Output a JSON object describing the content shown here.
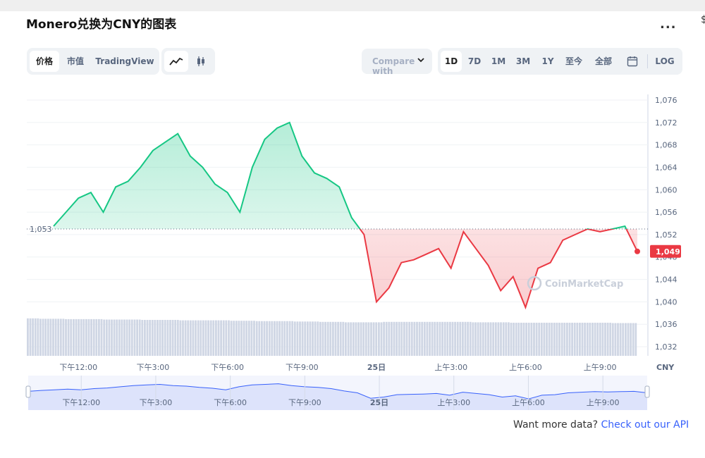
{
  "header": {
    "title": "Monero兑换为CNY的图表",
    "more_label": "...",
    "edge_glyph": "$"
  },
  "toolbar": {
    "view_tabs": [
      {
        "label": "价格",
        "active": true
      },
      {
        "label": "市值",
        "active": false
      },
      {
        "label": "TradingView",
        "active": false
      }
    ],
    "chart_types": [
      {
        "icon": "line-chart-icon",
        "active": true
      },
      {
        "icon": "candlestick-icon",
        "active": false
      }
    ],
    "compare": {
      "label": "Compare with"
    },
    "ranges": [
      {
        "label": "1D",
        "active": true
      },
      {
        "label": "7D",
        "active": false
      },
      {
        "label": "1M",
        "active": false
      },
      {
        "label": "3M",
        "active": false
      },
      {
        "label": "1Y",
        "active": false
      },
      {
        "label": "至今",
        "active": false
      },
      {
        "label": "全部",
        "active": false
      }
    ],
    "calendar_icon": "calendar-icon",
    "log_label": "LOG"
  },
  "colors": {
    "up": "#16c784",
    "down": "#ea3943",
    "volume": "#cfd6e4",
    "navigator_fill": "#dde3fb",
    "navigator_line": "#3861fb"
  },
  "chart_data": {
    "type": "line",
    "title": "Monero兑换为CNY的图表",
    "currency": "CNY",
    "baseline": 1053,
    "baseline_label": "1,053",
    "current_price_label": "1,049",
    "watermark": "CoinMarketCap",
    "yticks": [
      "1,076",
      "1,072",
      "1,068",
      "1,064",
      "1,060",
      "1,056",
      "1,052",
      "1,048",
      "1,044",
      "1,040",
      "1,036",
      "1,032"
    ],
    "ytick_values": [
      1076,
      1072,
      1068,
      1064,
      1060,
      1056,
      1052,
      1048,
      1044,
      1040,
      1036,
      1032
    ],
    "ylim": [
      1031,
      1077
    ],
    "xticks": [
      "下午12:00",
      "下午3:00",
      "下午6:00",
      "下午9:00",
      "25日",
      "上午3:00",
      "上午6:00",
      "上午9:00"
    ],
    "xtick_positions_hours": [
      1,
      4,
      7,
      10,
      13,
      16,
      19,
      22
    ],
    "x_hours": [
      0,
      0.5,
      1,
      1.5,
      2,
      2.5,
      3,
      3.5,
      4,
      4.5,
      5,
      5.5,
      6,
      6.5,
      7,
      7.5,
      8,
      8.5,
      9,
      9.5,
      10,
      10.5,
      11,
      11.5,
      12,
      12.5,
      13,
      13.5,
      14,
      14.5,
      15,
      15.5,
      16,
      16.5,
      17,
      17.5,
      18,
      18.5,
      19,
      19.5,
      20,
      20.5,
      21,
      21.5,
      22,
      22.5,
      23,
      23.5
    ],
    "prices": [
      1053.5,
      1056,
      1058.5,
      1059.5,
      1056,
      1060.5,
      1061.5,
      1064,
      1067,
      1068.5,
      1070,
      1066,
      1064,
      1061,
      1059.5,
      1056,
      1064,
      1069,
      1071,
      1072,
      1066,
      1063,
      1062,
      1060.5,
      1055,
      1052,
      1040,
      1042.5,
      1047,
      1047.5,
      1048.5,
      1049.5,
      1046,
      1052.5,
      1049.5,
      1046.5,
      1042,
      1044.5,
      1039,
      1046,
      1047,
      1051,
      1052,
      1053,
      1052.5,
      1053,
      1053.5,
      1049
    ],
    "volume": [
      95,
      94,
      94,
      93,
      93,
      93,
      92,
      92,
      92,
      91,
      91,
      91,
      90,
      90,
      90,
      90,
      89,
      89,
      88,
      88,
      88,
      87,
      87,
      86,
      86,
      85,
      85,
      85,
      86,
      86,
      86,
      86,
      86,
      86,
      86,
      85,
      85,
      85,
      84,
      84,
      84,
      84,
      84,
      84,
      84,
      84,
      83,
      83
    ],
    "navigator": [
      0.55,
      0.58,
      0.6,
      0.62,
      0.6,
      0.64,
      0.66,
      0.7,
      0.74,
      0.76,
      0.78,
      0.74,
      0.72,
      0.68,
      0.65,
      0.6,
      0.7,
      0.76,
      0.78,
      0.8,
      0.74,
      0.7,
      0.68,
      0.64,
      0.56,
      0.5,
      0.32,
      0.36,
      0.44,
      0.45,
      0.46,
      0.48,
      0.42,
      0.52,
      0.48,
      0.44,
      0.36,
      0.4,
      0.3,
      0.42,
      0.44,
      0.5,
      0.52,
      0.54,
      0.53,
      0.54,
      0.55,
      0.5
    ]
  },
  "footer": {
    "prefix": "Want more data?",
    "link": "Check out our API"
  }
}
